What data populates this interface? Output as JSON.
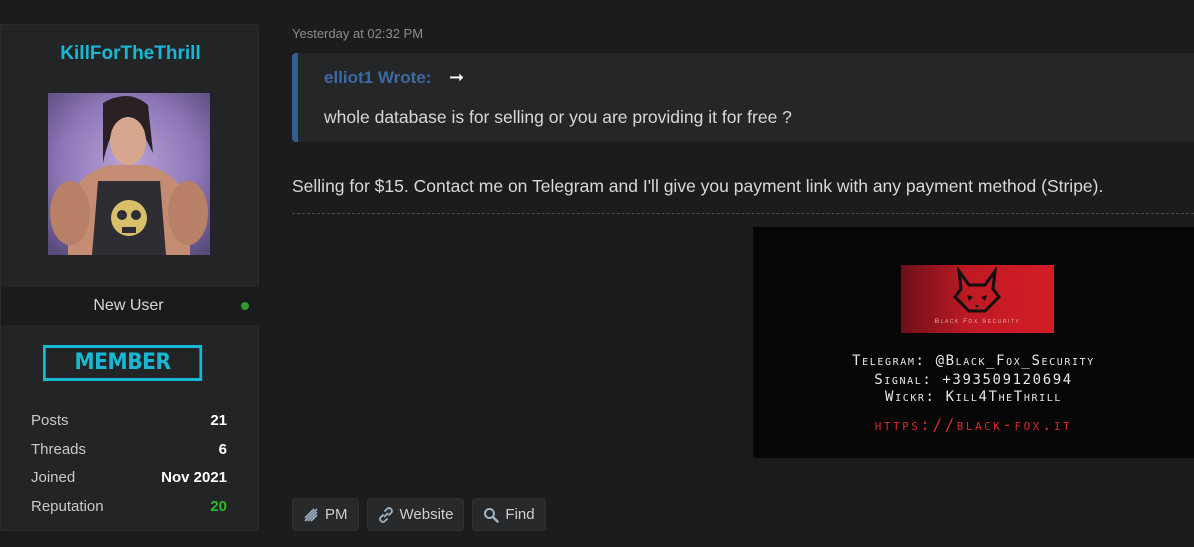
{
  "profile": {
    "username": "KillForTheThrill",
    "rank": "New User",
    "badge": "MEMBER",
    "online": true,
    "stats": [
      {
        "label": "Posts",
        "value": "21"
      },
      {
        "label": "Threads",
        "value": "6"
      },
      {
        "label": "Joined",
        "value": "Nov 2021"
      },
      {
        "label": "Reputation",
        "value": "20"
      }
    ]
  },
  "post": {
    "timestamp": "Yesterday at 02:32 PM",
    "quote": {
      "author": "elliot1 Wrote:",
      "text": "whole database is for selling or you are providing it for free ?"
    },
    "body": "Selling for $15. Contact me on Telegram and I'll give you payment link with any payment method (Stripe).",
    "signature": {
      "logo_text": "Black Fox Security",
      "telegram": "Telegram: @Black_Fox_Security",
      "signal": "Signal: +393509120694",
      "wickr": "Wickr: Kill4TheThrill",
      "url": "https://black-fox.it"
    }
  },
  "actions": {
    "pm": "PM",
    "website": "Website",
    "find": "Find"
  },
  "colors": {
    "accent": "#17b8d1",
    "quote_author": "#3c6aa5",
    "reputation": "#2fbb25",
    "online": "#2e9b2e"
  }
}
